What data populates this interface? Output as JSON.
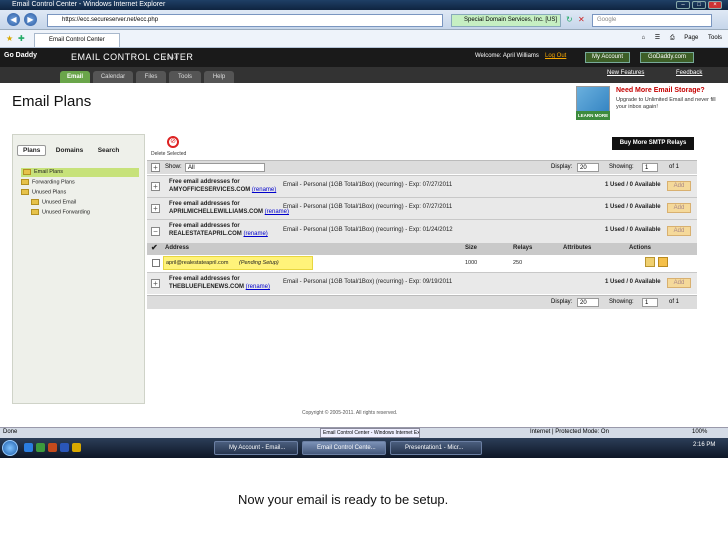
{
  "window": {
    "title": "Email Control Center - Windows Internet Explorer"
  },
  "browser": {
    "url": "https://ecc.secureserver.net/ecc.php",
    "cert": "Special Domain Services, Inc. [US]",
    "search_placeholder": "Google",
    "tab": "Email Control Center",
    "cmd": [
      "Page",
      "Tools"
    ]
  },
  "app": {
    "logo": "Go Daddy",
    "name": "EMAIL CONTROL CENTER",
    "version": "v 3.4.0",
    "welcome": "Welcome: April Williams",
    "logout": "Log Out",
    "my_account": "My Account",
    "godaddy": "GoDaddy.com",
    "menu": [
      "Email",
      "Calendar",
      "Files",
      "Tools",
      "Help"
    ],
    "new_features": "New Features",
    "feedback": "Feedback"
  },
  "page": {
    "title": "Email Plans"
  },
  "promo": {
    "head": "Need More Email Storage?",
    "sub": "Upgrade to Unlimited Email and never fill your inbox again!",
    "btn": "LEARN MORE"
  },
  "sidebar": {
    "tabs": [
      "Plans",
      "Domains",
      "Search"
    ],
    "tree": [
      "Email Plans",
      "Forwarding Plans",
      "Unused Plans",
      "Unused Email",
      "Unused Forwarding"
    ]
  },
  "main": {
    "delete_label": "Delete Selected",
    "smtp_btn": "Buy More SMTP Relays",
    "show_label": "Show:",
    "show_value": "All",
    "display_label": "Display:",
    "display_value": "20",
    "showing_label": "Showing:",
    "page_value": "1",
    "of_label": "of 1",
    "rename": "(rename)",
    "add": "Add",
    "plans": [
      {
        "title": "Free email addresses for",
        "domain": "AMYOFFICESERVICES.COM",
        "desc": "Email - Personal (1GB Total/1Box) (recurring) - Exp: 07/27/2011",
        "usage": "1 Used / 0 Available"
      },
      {
        "title": "Free email addresses for",
        "domain": "APRILMICHELLEWILLIAMS.COM",
        "desc": "Email - Personal (1GB Total/1Box) (recurring) - Exp: 07/27/2011",
        "usage": "1 Used / 0 Available"
      },
      {
        "title": "Free email addresses for",
        "domain": "REALESTATEAPRIL.COM",
        "desc": "Email - Personal (1GB Total/1Box) (recurring) - Exp: 01/24/2012",
        "usage": "1 Used / 0 Available"
      },
      {
        "title": "Free email addresses for",
        "domain": "THEBLUEFILENEWS.COM",
        "desc": "Email - Personal (1GB Total/1Box) (recurring) - Exp: 09/19/2011",
        "usage": "1 Used / 0 Available"
      }
    ],
    "cols": [
      "Address",
      "Size",
      "Relays",
      "Attributes",
      "Actions"
    ],
    "address_row": {
      "address": "april@realestateapril.com",
      "status": "(Pending Setup)",
      "size": "1000",
      "relays": "250"
    }
  },
  "copyright": "Copyright © 2005-2011. All rights reserved.",
  "status": {
    "left": "Done",
    "tab": "Email Control Center - Windows Internet Explorer",
    "zone": "Internet | Protected Mode: On",
    "zoom": "100%"
  },
  "taskbar": {
    "tasks": [
      "My Account - Email...",
      "Email Control Cente...",
      "Presentation1 - Micr..."
    ],
    "clock": "2:16 PM"
  },
  "caption": "Now your email is ready to be setup."
}
